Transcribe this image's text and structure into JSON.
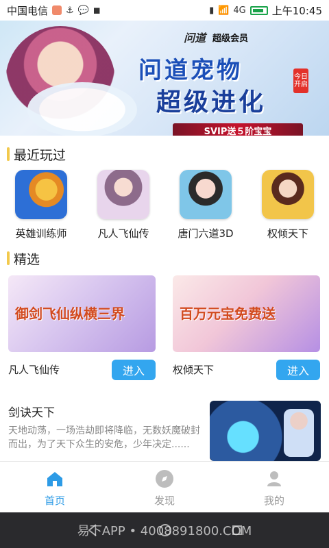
{
  "status_bar": {
    "carrier": "中国电信",
    "time": "上午10:45",
    "signal_text": "4G",
    "battery_label": ""
  },
  "banner": {
    "logo_text": "问道",
    "badge_text": "超级会员",
    "title_line1": "问道宠物",
    "title_line2": "超级进化",
    "date_badge": "今日开启",
    "svip_text": "SVIP送５阶宝宝"
  },
  "sections": {
    "recent": "最近玩过",
    "featured": "精选"
  },
  "recent_games": [
    {
      "name": "英雄训练师"
    },
    {
      "name": "凡人飞仙传"
    },
    {
      "name": "唐门六道3D"
    },
    {
      "name": "权倾天下"
    }
  ],
  "featured_games": [
    {
      "title": "凡人飞仙传",
      "button": "进入",
      "overlay": "御剑飞仙纵横三界"
    },
    {
      "title": "权倾天下",
      "button": "进入",
      "overlay": "百万元宝免费送"
    }
  ],
  "list_game": {
    "title": "剑诀天下",
    "description": "天地动荡，一场浩劫即将降临，无数妖魔破封而出，为了天下众生的安危，少年决定......"
  },
  "bottom_nav": [
    {
      "label": "首页"
    },
    {
      "label": "发现"
    },
    {
      "label": "我的"
    }
  ],
  "system_bar": {
    "watermark": "易下APP • 4008891800.COM"
  },
  "colors": {
    "accent": "#33a6ef",
    "nav_active": "#2d9be6",
    "section_bar": "#f2c94c"
  },
  "icons": {
    "home": "home-icon",
    "discover": "compass-icon",
    "mine": "user-icon"
  }
}
